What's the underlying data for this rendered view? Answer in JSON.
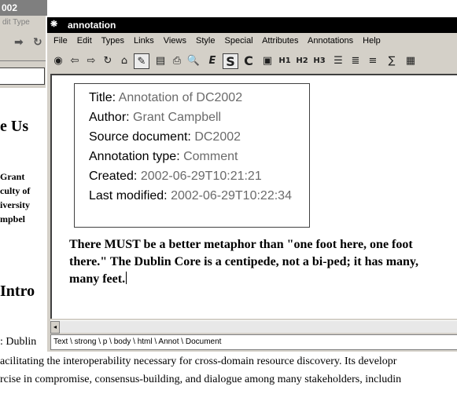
{
  "background_window": {
    "title": "002",
    "menu_text": "dit  Type",
    "heading1": "e Us",
    "author_name": "Grant",
    "author_affil1": "culty of",
    "author_affil2": "iversity",
    "author_email": "mpbel",
    "heading2": "Intro",
    "para_start": ": Dublin",
    "body_line1": "acilitating the interoperability necessary for cross-domain resource discovery. Its developr",
    "body_line2": "rcise in compromise, consensus-building, and dialogue among many stakeholders, includin"
  },
  "window": {
    "title": "annotation",
    "menu": [
      "File",
      "Edit",
      "Types",
      "Links",
      "Views",
      "Style",
      "Special",
      "Attributes",
      "Annotations",
      "Help"
    ],
    "toolbar": [
      {
        "name": "stop-icon",
        "glyph": "◉"
      },
      {
        "name": "back-icon",
        "glyph": "⇦"
      },
      {
        "name": "forward-icon",
        "glyph": "⇨"
      },
      {
        "name": "reload-icon",
        "glyph": "↻"
      },
      {
        "name": "home-icon",
        "glyph": "⌂"
      },
      {
        "name": "edit-pencil-icon",
        "glyph": "✎"
      },
      {
        "name": "save-icon",
        "glyph": "▤"
      },
      {
        "name": "print-icon",
        "glyph": "⎙"
      },
      {
        "name": "find-icon",
        "glyph": "🔍"
      },
      {
        "name": "emphasis-icon",
        "glyph": "E"
      },
      {
        "name": "strong-icon",
        "glyph": "S"
      },
      {
        "name": "code-icon",
        "glyph": "C"
      },
      {
        "name": "image-icon",
        "glyph": "▣"
      },
      {
        "name": "heading1-icon",
        "glyph": "H1"
      },
      {
        "name": "heading2-icon",
        "glyph": "H2"
      },
      {
        "name": "heading3-icon",
        "glyph": "H3"
      },
      {
        "name": "bullet-list-icon",
        "glyph": "☰"
      },
      {
        "name": "numbered-list-icon",
        "glyph": "≣"
      },
      {
        "name": "definition-list-icon",
        "glyph": "≡"
      },
      {
        "name": "math-icon",
        "glyph": "∑"
      },
      {
        "name": "table-icon",
        "glyph": "▦"
      }
    ]
  },
  "annotation": {
    "title_label": "Title:",
    "title_value": "Annotation of DC2002",
    "author_label": "Author:",
    "author_value": "Grant Campbell",
    "source_label": "Source document:",
    "source_value": "DC2002",
    "type_label": "Annotation type:",
    "type_value": "Comment",
    "created_label": "Created:",
    "created_value": "2002-06-29T10:21:21",
    "modified_label": "Last modified:",
    "modified_value": "2002-06-29T10:22:34",
    "body": "There MUST be a better metaphor than \"one foot here, one foot there.\"  The Dublin Core is a centipede, not a bi-ped; it has many, many feet."
  },
  "status_path": "Text \\ strong \\ p \\ body \\ html \\ Annot \\ Document",
  "scroll_left_glyph": "◂"
}
